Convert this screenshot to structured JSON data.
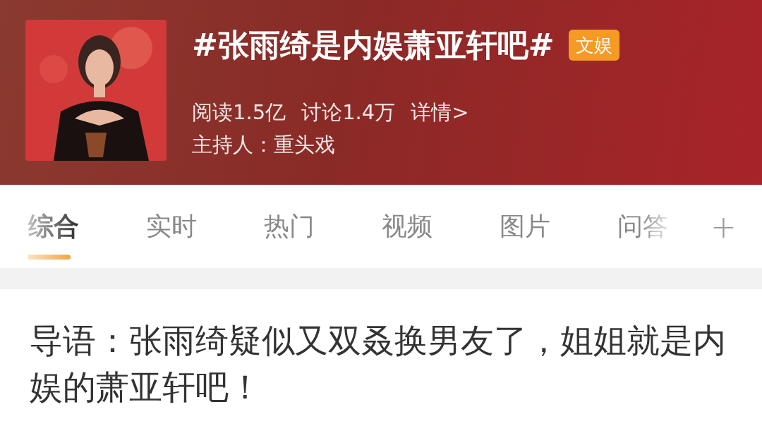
{
  "topic": {
    "title": "#张雨绮是内娱萧亚轩吧#",
    "badge": "文娱",
    "stats": [
      "阅读1.5亿",
      "讨论1.4万",
      "详情>"
    ],
    "host": "主持人：重头戏"
  },
  "tabs": [
    {
      "label": "综合",
      "selected": true
    },
    {
      "label": "实时",
      "selected": false
    },
    {
      "label": "热门",
      "selected": false
    },
    {
      "label": "视频",
      "selected": false
    },
    {
      "label": "图片",
      "selected": false
    },
    {
      "label": "问答",
      "selected": false
    }
  ],
  "add_tab": "+",
  "intro": "导语：张雨绮疑似又双叒换男友了，姐姐就是内娱的萧亚轩吧！"
}
